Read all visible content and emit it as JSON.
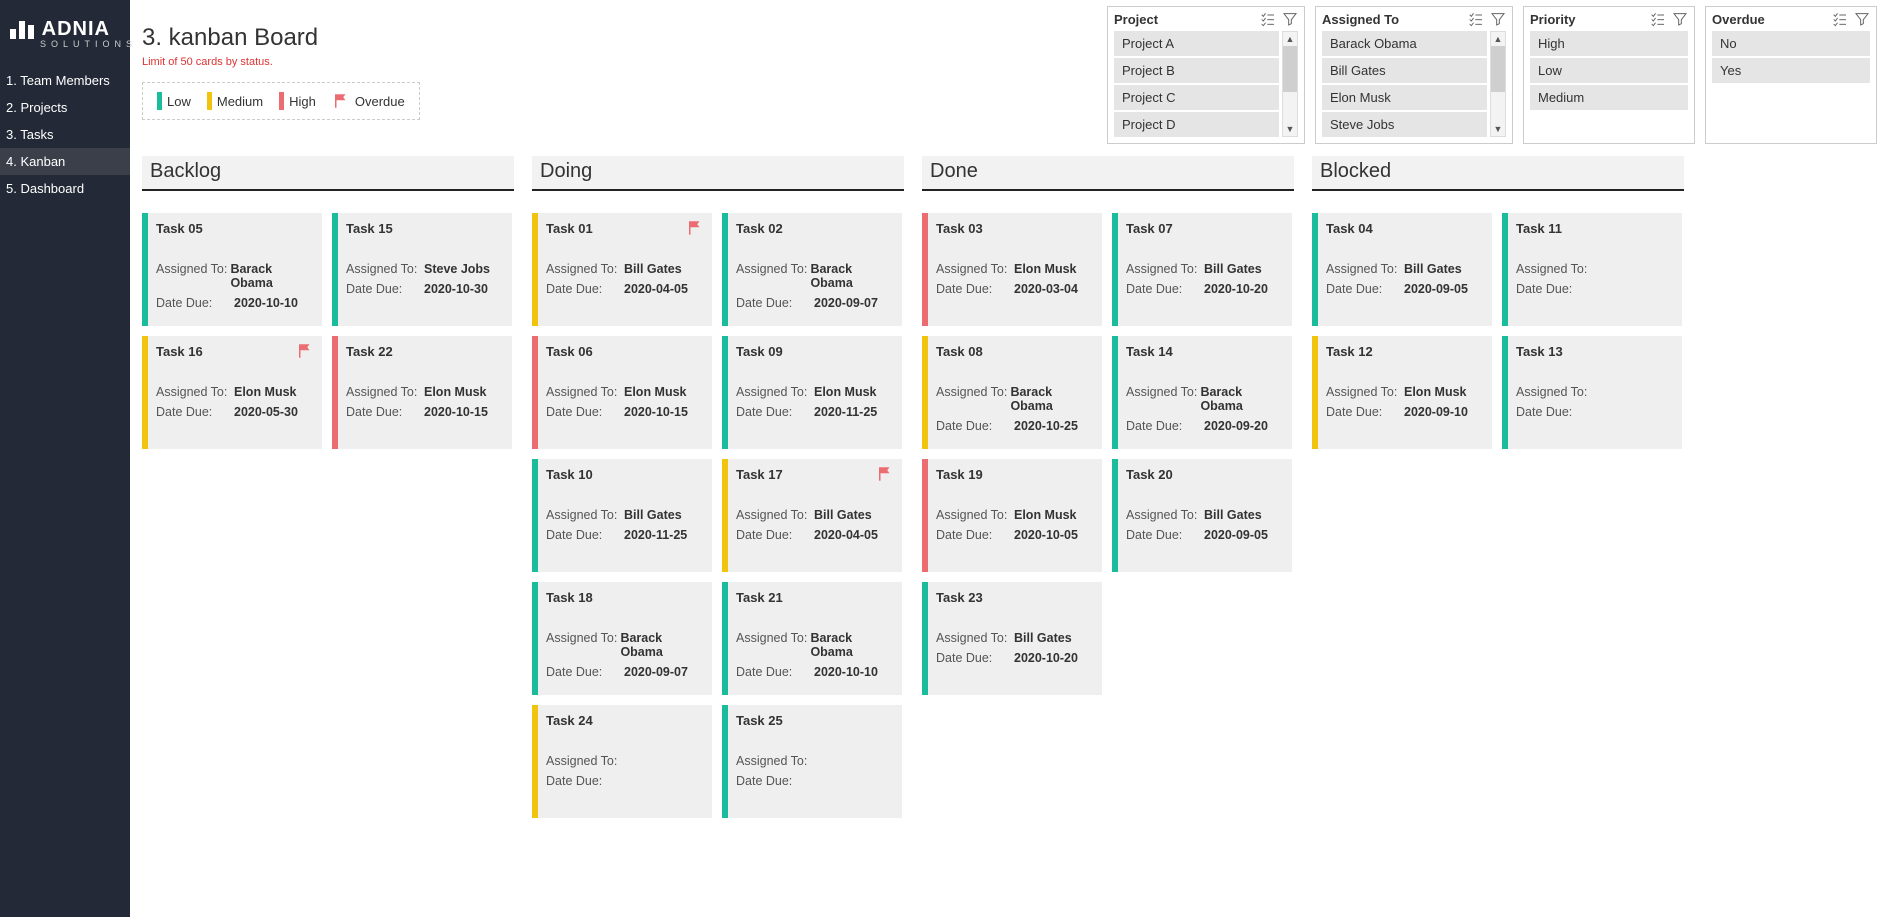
{
  "brand": {
    "name": "ADNIA",
    "sub": "SOLUTIONS"
  },
  "nav": [
    {
      "label": "1. Team Members",
      "active": false
    },
    {
      "label": "2. Projects",
      "active": false
    },
    {
      "label": "3. Tasks",
      "active": false
    },
    {
      "label": "4. Kanban",
      "active": true
    },
    {
      "label": "5. Dashboard",
      "active": false
    }
  ],
  "page": {
    "title": "3. kanban Board",
    "limit_text": "Limit of 50 cards by status."
  },
  "legend": {
    "low": "Low",
    "medium": "Medium",
    "high": "High",
    "overdue": "Overdue"
  },
  "filters": [
    {
      "title": "Project",
      "scroll": true,
      "options": [
        "Project A",
        "Project B",
        "Project C",
        "Project D"
      ]
    },
    {
      "title": "Assigned To",
      "scroll": true,
      "options": [
        "Barack Obama",
        "Bill Gates",
        "Elon Musk",
        "Steve Jobs"
      ]
    },
    {
      "title": "Priority",
      "scroll": false,
      "options": [
        "High",
        "Low",
        "Medium"
      ]
    },
    {
      "title": "Overdue",
      "scroll": false,
      "options": [
        "No",
        "Yes"
      ]
    }
  ],
  "labels": {
    "assigned_to": "Assigned To:",
    "date_due": "Date Due:"
  },
  "columns": [
    {
      "title": "Backlog",
      "cards": [
        {
          "title": "Task 05",
          "priority": "low",
          "assigned": "Barack Obama",
          "due": "2020-10-10",
          "overdue": false
        },
        {
          "title": "Task 15",
          "priority": "low",
          "assigned": "Steve Jobs",
          "due": "2020-10-30",
          "overdue": false
        },
        {
          "title": "Task 16",
          "priority": "med",
          "assigned": "Elon Musk",
          "due": "2020-05-30",
          "overdue": true
        },
        {
          "title": "Task 22",
          "priority": "high",
          "assigned": "Elon Musk",
          "due": "2020-10-15",
          "overdue": false
        }
      ]
    },
    {
      "title": "Doing",
      "cards": [
        {
          "title": "Task 01",
          "priority": "med",
          "assigned": "Bill Gates",
          "due": "2020-04-05",
          "overdue": true
        },
        {
          "title": "Task 02",
          "priority": "low",
          "assigned": "Barack Obama",
          "due": "2020-09-07",
          "overdue": false
        },
        {
          "title": "Task 06",
          "priority": "high",
          "assigned": "Elon Musk",
          "due": "2020-10-15",
          "overdue": false
        },
        {
          "title": "Task 09",
          "priority": "low",
          "assigned": "Elon Musk",
          "due": "2020-11-25",
          "overdue": false
        },
        {
          "title": "Task 10",
          "priority": "low",
          "assigned": "Bill Gates",
          "due": "2020-11-25",
          "overdue": false
        },
        {
          "title": "Task 17",
          "priority": "med",
          "assigned": "Bill Gates",
          "due": "2020-04-05",
          "overdue": true
        },
        {
          "title": "Task 18",
          "priority": "low",
          "assigned": "Barack Obama",
          "due": "2020-09-07",
          "overdue": false
        },
        {
          "title": "Task 21",
          "priority": "low",
          "assigned": "Barack Obama",
          "due": "2020-10-10",
          "overdue": false
        },
        {
          "title": "Task 24",
          "priority": "med",
          "assigned": "",
          "due": "",
          "overdue": false
        },
        {
          "title": "Task 25",
          "priority": "low",
          "assigned": "",
          "due": "",
          "overdue": false
        }
      ]
    },
    {
      "title": "Done",
      "cards": [
        {
          "title": "Task 03",
          "priority": "high",
          "assigned": "Elon Musk",
          "due": "2020-03-04",
          "overdue": false
        },
        {
          "title": "Task 07",
          "priority": "low",
          "assigned": "Bill Gates",
          "due": "2020-10-20",
          "overdue": false
        },
        {
          "title": "Task 08",
          "priority": "med",
          "assigned": "Barack Obama",
          "due": "2020-10-25",
          "overdue": false
        },
        {
          "title": "Task 14",
          "priority": "low",
          "assigned": "Barack Obama",
          "due": "2020-09-20",
          "overdue": false
        },
        {
          "title": "Task 19",
          "priority": "high",
          "assigned": "Elon Musk",
          "due": "2020-10-05",
          "overdue": false
        },
        {
          "title": "Task 20",
          "priority": "low",
          "assigned": "Bill Gates",
          "due": "2020-09-05",
          "overdue": false
        },
        {
          "title": "Task 23",
          "priority": "low",
          "assigned": "Bill Gates",
          "due": "2020-10-20",
          "overdue": false
        }
      ]
    },
    {
      "title": "Blocked",
      "cards": [
        {
          "title": "Task 04",
          "priority": "low",
          "assigned": "Bill Gates",
          "due": "2020-09-05",
          "overdue": false
        },
        {
          "title": "Task 11",
          "priority": "low",
          "assigned": "",
          "due": "",
          "overdue": false
        },
        {
          "title": "Task 12",
          "priority": "med",
          "assigned": "Elon Musk",
          "due": "2020-09-10",
          "overdue": false
        },
        {
          "title": "Task 13",
          "priority": "low",
          "assigned": "",
          "due": "",
          "overdue": false
        }
      ]
    }
  ]
}
